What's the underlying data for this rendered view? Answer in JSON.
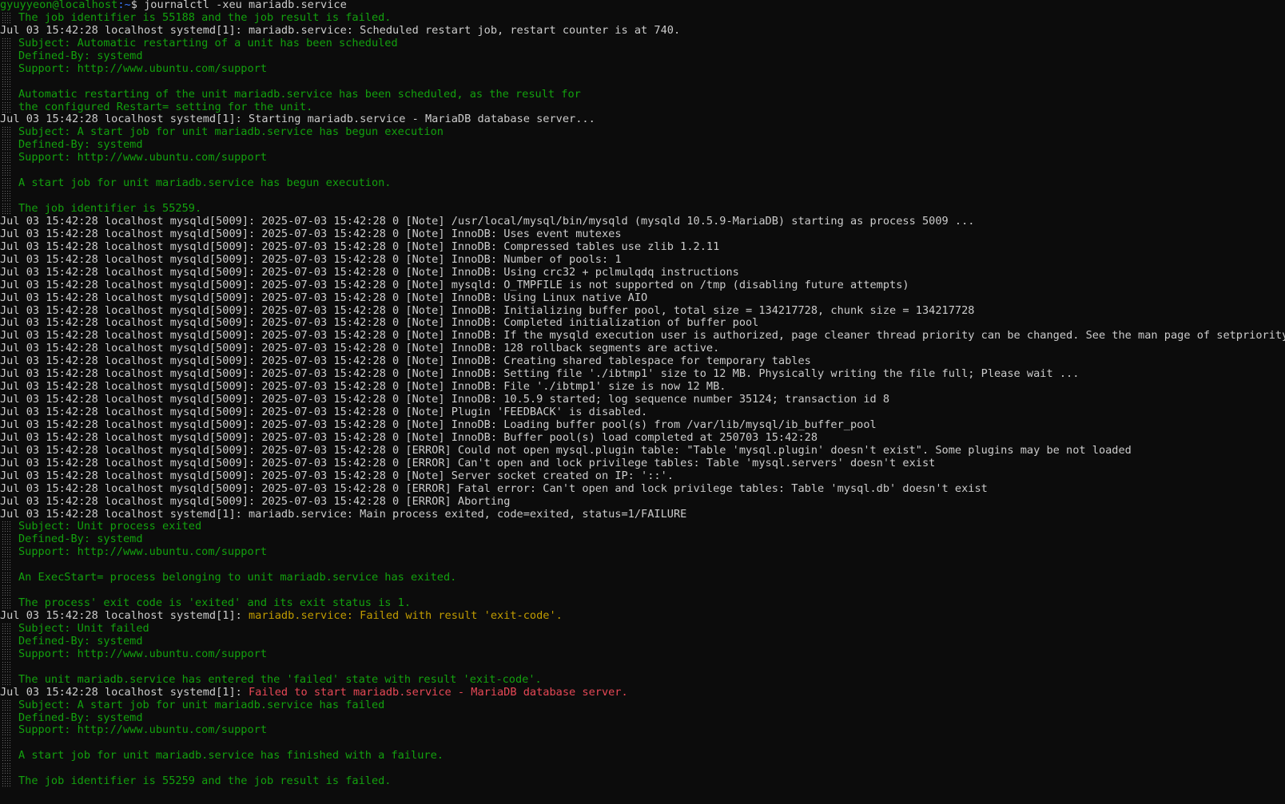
{
  "terminal": {
    "prompt": {
      "user_host": "gyuyyeon@localhost",
      "path": ":~",
      "symbol": "$ ",
      "command": "journalctl -xeu mariadb.service"
    },
    "colors": {
      "background": "#0c0c0c",
      "default_text": "#cccccc",
      "catalog_text": "#13a10e",
      "warning_text": "#c19c00",
      "error_text": "#e74856",
      "prompt_user": "#13a10e",
      "prompt_path": "#3b78ff"
    },
    "lines": [
      {
        "type": "cat",
        "text": "The job identifier is 55188 and the job result is failed."
      },
      {
        "type": "log",
        "prefix": "Jul 03 15:42:28 localhost systemd[1]: ",
        "message": "mariadb.service: Scheduled restart job, restart counter is at 740.",
        "level": "normal"
      },
      {
        "type": "cat",
        "text": "Subject: Automatic restarting of a unit has been scheduled"
      },
      {
        "type": "cat",
        "text": "Defined-By: systemd"
      },
      {
        "type": "cat",
        "text": "Support: http://www.ubuntu.com/support"
      },
      {
        "type": "cat",
        "text": ""
      },
      {
        "type": "cat",
        "text": "Automatic restarting of the unit mariadb.service has been scheduled, as the result for"
      },
      {
        "type": "cat",
        "text": "the configured Restart= setting for the unit."
      },
      {
        "type": "log",
        "prefix": "Jul 03 15:42:28 localhost systemd[1]: ",
        "message": "Starting mariadb.service - MariaDB database server...",
        "level": "normal"
      },
      {
        "type": "cat",
        "text": "Subject: A start job for unit mariadb.service has begun execution"
      },
      {
        "type": "cat",
        "text": "Defined-By: systemd"
      },
      {
        "type": "cat",
        "text": "Support: http://www.ubuntu.com/support"
      },
      {
        "type": "cat",
        "text": ""
      },
      {
        "type": "cat",
        "text": "A start job for unit mariadb.service has begun execution."
      },
      {
        "type": "cat",
        "text": ""
      },
      {
        "type": "cat",
        "text": "The job identifier is 55259."
      },
      {
        "type": "log",
        "prefix": "Jul 03 15:42:28 localhost mysqld[5009]: ",
        "message": "2025-07-03 15:42:28 0 [Note] /usr/local/mysql/bin/mysqld (mysqld 10.5.9-MariaDB) starting as process 5009 ...",
        "level": "normal"
      },
      {
        "type": "log",
        "prefix": "Jul 03 15:42:28 localhost mysqld[5009]: ",
        "message": "2025-07-03 15:42:28 0 [Note] InnoDB: Uses event mutexes",
        "level": "normal"
      },
      {
        "type": "log",
        "prefix": "Jul 03 15:42:28 localhost mysqld[5009]: ",
        "message": "2025-07-03 15:42:28 0 [Note] InnoDB: Compressed tables use zlib 1.2.11",
        "level": "normal"
      },
      {
        "type": "log",
        "prefix": "Jul 03 15:42:28 localhost mysqld[5009]: ",
        "message": "2025-07-03 15:42:28 0 [Note] InnoDB: Number of pools: 1",
        "level": "normal"
      },
      {
        "type": "log",
        "prefix": "Jul 03 15:42:28 localhost mysqld[5009]: ",
        "message": "2025-07-03 15:42:28 0 [Note] InnoDB: Using crc32 + pclmulqdq instructions",
        "level": "normal"
      },
      {
        "type": "log",
        "prefix": "Jul 03 15:42:28 localhost mysqld[5009]: ",
        "message": "2025-07-03 15:42:28 0 [Note] mysqld: O_TMPFILE is not supported on /tmp (disabling future attempts)",
        "level": "normal"
      },
      {
        "type": "log",
        "prefix": "Jul 03 15:42:28 localhost mysqld[5009]: ",
        "message": "2025-07-03 15:42:28 0 [Note] InnoDB: Using Linux native AIO",
        "level": "normal"
      },
      {
        "type": "log",
        "prefix": "Jul 03 15:42:28 localhost mysqld[5009]: ",
        "message": "2025-07-03 15:42:28 0 [Note] InnoDB: Initializing buffer pool, total size = 134217728, chunk size = 134217728",
        "level": "normal"
      },
      {
        "type": "log",
        "prefix": "Jul 03 15:42:28 localhost mysqld[5009]: ",
        "message": "2025-07-03 15:42:28 0 [Note] InnoDB: Completed initialization of buffer pool",
        "level": "normal"
      },
      {
        "type": "log",
        "prefix": "Jul 03 15:42:28 localhost mysqld[5009]: ",
        "message": "2025-07-03 15:42:28 0 [Note] InnoDB: If the mysqld execution user is authorized, page cleaner thread priority can be changed. See the man page of setpriority().",
        "level": "normal"
      },
      {
        "type": "log",
        "prefix": "Jul 03 15:42:28 localhost mysqld[5009]: ",
        "message": "2025-07-03 15:42:28 0 [Note] InnoDB: 128 rollback segments are active.",
        "level": "normal"
      },
      {
        "type": "log",
        "prefix": "Jul 03 15:42:28 localhost mysqld[5009]: ",
        "message": "2025-07-03 15:42:28 0 [Note] InnoDB: Creating shared tablespace for temporary tables",
        "level": "normal"
      },
      {
        "type": "log",
        "prefix": "Jul 03 15:42:28 localhost mysqld[5009]: ",
        "message": "2025-07-03 15:42:28 0 [Note] InnoDB: Setting file './ibtmp1' size to 12 MB. Physically writing the file full; Please wait ...",
        "level": "normal"
      },
      {
        "type": "log",
        "prefix": "Jul 03 15:42:28 localhost mysqld[5009]: ",
        "message": "2025-07-03 15:42:28 0 [Note] InnoDB: File './ibtmp1' size is now 12 MB.",
        "level": "normal"
      },
      {
        "type": "log",
        "prefix": "Jul 03 15:42:28 localhost mysqld[5009]: ",
        "message": "2025-07-03 15:42:28 0 [Note] InnoDB: 10.5.9 started; log sequence number 35124; transaction id 8",
        "level": "normal"
      },
      {
        "type": "log",
        "prefix": "Jul 03 15:42:28 localhost mysqld[5009]: ",
        "message": "2025-07-03 15:42:28 0 [Note] Plugin 'FEEDBACK' is disabled.",
        "level": "normal"
      },
      {
        "type": "log",
        "prefix": "Jul 03 15:42:28 localhost mysqld[5009]: ",
        "message": "2025-07-03 15:42:28 0 [Note] InnoDB: Loading buffer pool(s) from /var/lib/mysql/ib_buffer_pool",
        "level": "normal"
      },
      {
        "type": "log",
        "prefix": "Jul 03 15:42:28 localhost mysqld[5009]: ",
        "message": "2025-07-03 15:42:28 0 [Note] InnoDB: Buffer pool(s) load completed at 250703 15:42:28",
        "level": "normal"
      },
      {
        "type": "log",
        "prefix": "Jul 03 15:42:28 localhost mysqld[5009]: ",
        "message": "2025-07-03 15:42:28 0 [ERROR] Could not open mysql.plugin table: \"Table 'mysql.plugin' doesn't exist\". Some plugins may be not loaded",
        "level": "normal"
      },
      {
        "type": "log",
        "prefix": "Jul 03 15:42:28 localhost mysqld[5009]: ",
        "message": "2025-07-03 15:42:28 0 [ERROR] Can't open and lock privilege tables: Table 'mysql.servers' doesn't exist",
        "level": "normal"
      },
      {
        "type": "log",
        "prefix": "Jul 03 15:42:28 localhost mysqld[5009]: ",
        "message": "2025-07-03 15:42:28 0 [Note] Server socket created on IP: '::'.",
        "level": "normal"
      },
      {
        "type": "log",
        "prefix": "Jul 03 15:42:28 localhost mysqld[5009]: ",
        "message": "2025-07-03 15:42:28 0 [ERROR] Fatal error: Can't open and lock privilege tables: Table 'mysql.db' doesn't exist",
        "level": "normal"
      },
      {
        "type": "log",
        "prefix": "Jul 03 15:42:28 localhost mysqld[5009]: ",
        "message": "2025-07-03 15:42:28 0 [ERROR] Aborting",
        "level": "normal"
      },
      {
        "type": "log",
        "prefix": "Jul 03 15:42:28 localhost systemd[1]: ",
        "message": "mariadb.service: Main process exited, code=exited, status=1/FAILURE",
        "level": "normal"
      },
      {
        "type": "cat",
        "text": "Subject: Unit process exited"
      },
      {
        "type": "cat",
        "text": "Defined-By: systemd"
      },
      {
        "type": "cat",
        "text": "Support: http://www.ubuntu.com/support"
      },
      {
        "type": "cat",
        "text": ""
      },
      {
        "type": "cat",
        "text": "An ExecStart= process belonging to unit mariadb.service has exited."
      },
      {
        "type": "cat",
        "text": ""
      },
      {
        "type": "cat",
        "text": "The process' exit code is 'exited' and its exit status is 1."
      },
      {
        "type": "log",
        "prefix": "Jul 03 15:42:28 localhost systemd[1]: ",
        "message": "mariadb.service: Failed with result 'exit-code'.",
        "level": "warn"
      },
      {
        "type": "cat",
        "text": "Subject: Unit failed"
      },
      {
        "type": "cat",
        "text": "Defined-By: systemd"
      },
      {
        "type": "cat",
        "text": "Support: http://www.ubuntu.com/support"
      },
      {
        "type": "cat",
        "text": ""
      },
      {
        "type": "cat",
        "text": "The unit mariadb.service has entered the 'failed' state with result 'exit-code'."
      },
      {
        "type": "log",
        "prefix": "Jul 03 15:42:28 localhost systemd[1]: ",
        "message": "Failed to start mariadb.service - MariaDB database server.",
        "level": "fail"
      },
      {
        "type": "cat",
        "text": "Subject: A start job for unit mariadb.service has failed"
      },
      {
        "type": "cat",
        "text": "Defined-By: systemd"
      },
      {
        "type": "cat",
        "text": "Support: http://www.ubuntu.com/support"
      },
      {
        "type": "cat",
        "text": ""
      },
      {
        "type": "cat",
        "text": "A start job for unit mariadb.service has finished with a failure."
      },
      {
        "type": "cat",
        "text": ""
      },
      {
        "type": "cat",
        "text": "The job identifier is 55259 and the job result is failed."
      }
    ]
  }
}
